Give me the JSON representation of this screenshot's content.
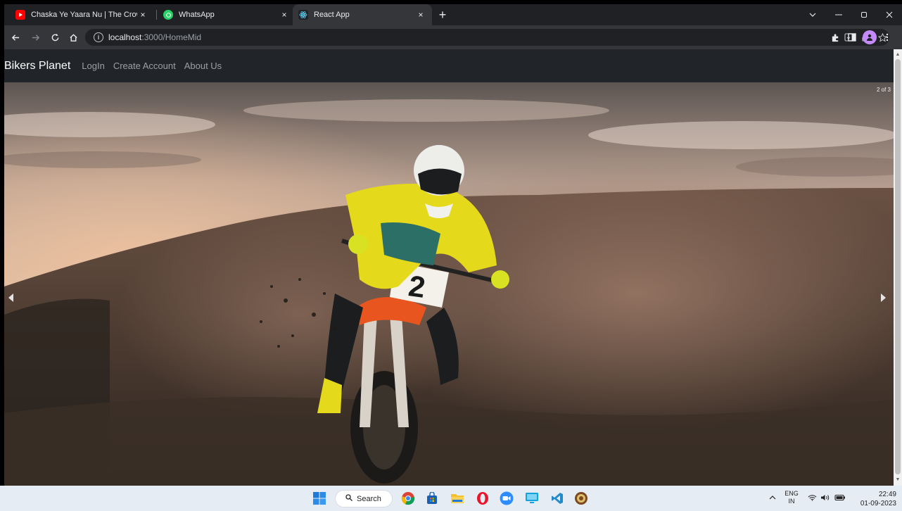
{
  "browser": {
    "tabs": [
      {
        "title": "Chaska Ye Yaara Nu | The Crown",
        "close": "×",
        "favicon": "youtube-icon",
        "color": "#ff0000"
      },
      {
        "title": "WhatsApp",
        "close": "×",
        "favicon": "whatsapp-icon",
        "color": "#25d366"
      },
      {
        "title": "React App",
        "close": "×",
        "favicon": "react-icon",
        "color": "#61dafb",
        "active": true
      }
    ],
    "new_tab": "+",
    "url_host": "localhost",
    "url_rest": ":3000/HomeMid"
  },
  "page": {
    "navbar": {
      "brand": "Bikers Planet",
      "links": [
        "LogIn",
        "Create Account",
        "About Us"
      ],
      "background": "#212529"
    },
    "carousel": {
      "counter": "2 of 3",
      "prev_icon": "chevron-left-icon",
      "next_icon": "chevron-right-icon",
      "rider_number": "2"
    }
  },
  "taskbar": {
    "search_label": "Search",
    "lang_top": "ENG",
    "lang_bottom": "IN",
    "time": "22:49",
    "date": "01-09-2023"
  }
}
